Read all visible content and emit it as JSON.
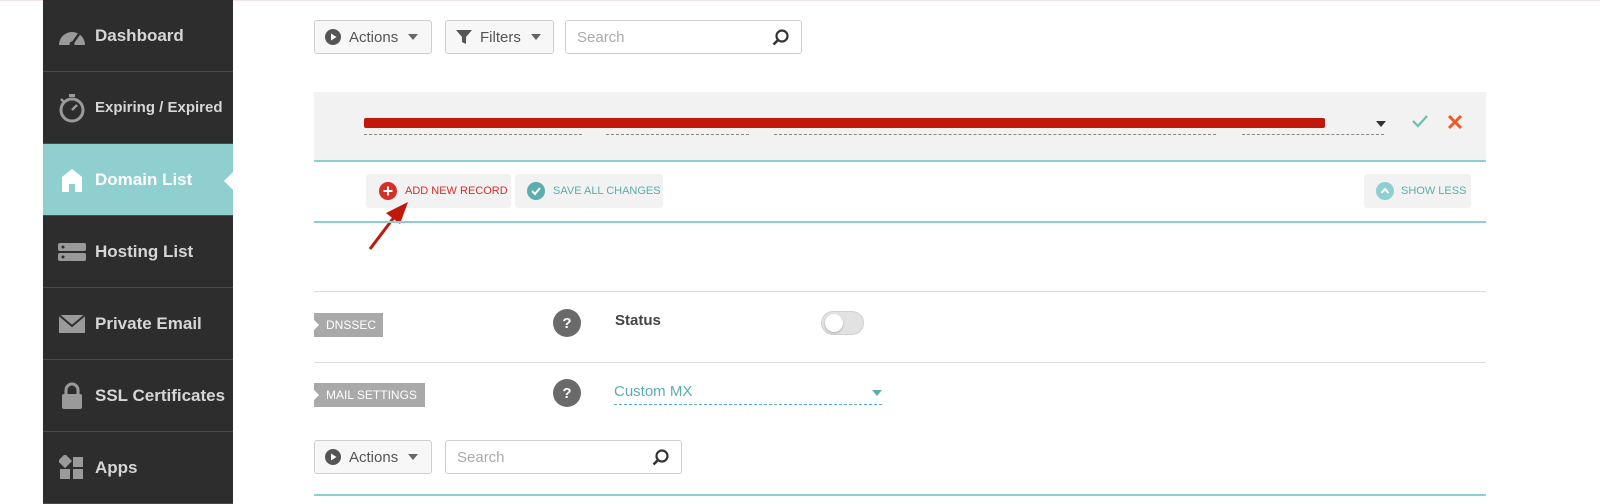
{
  "sidebar": {
    "items": [
      {
        "label": "Dashboard",
        "icon": "speedometer-icon"
      },
      {
        "label": "Expiring / Expired",
        "icon": "stopwatch-icon"
      },
      {
        "label": "Domain List",
        "icon": "home-icon",
        "active": true
      },
      {
        "label": "Hosting List",
        "icon": "server-icon"
      },
      {
        "label": "Private Email",
        "icon": "envelope-icon"
      },
      {
        "label": "SSL Certificates",
        "icon": "lock-icon"
      },
      {
        "label": "Apps",
        "icon": "apps-grid-icon"
      }
    ]
  },
  "toolbar": {
    "actions_label": "Actions",
    "filters_label": "Filters",
    "search_placeholder": "Search"
  },
  "records": {
    "add_new_record": "ADD NEW RECORD",
    "save_all_changes": "SAVE ALL CHANGES",
    "show_less": "SHOW LESS"
  },
  "dnssec": {
    "tag": "DNSSEC",
    "help": "?",
    "status_label": "Status",
    "enabled": false
  },
  "mail_settings": {
    "tag": "MAIL SETTINGS",
    "help": "?",
    "selected": "Custom MX"
  },
  "mail_toolbar": {
    "actions_label": "Actions",
    "search_placeholder": "Search"
  },
  "colors": {
    "sidebar_bg": "#2d2d2d",
    "active_bg": "#8fcfcf",
    "accent_red": "#d4302a",
    "teal": "#5aaeae"
  }
}
